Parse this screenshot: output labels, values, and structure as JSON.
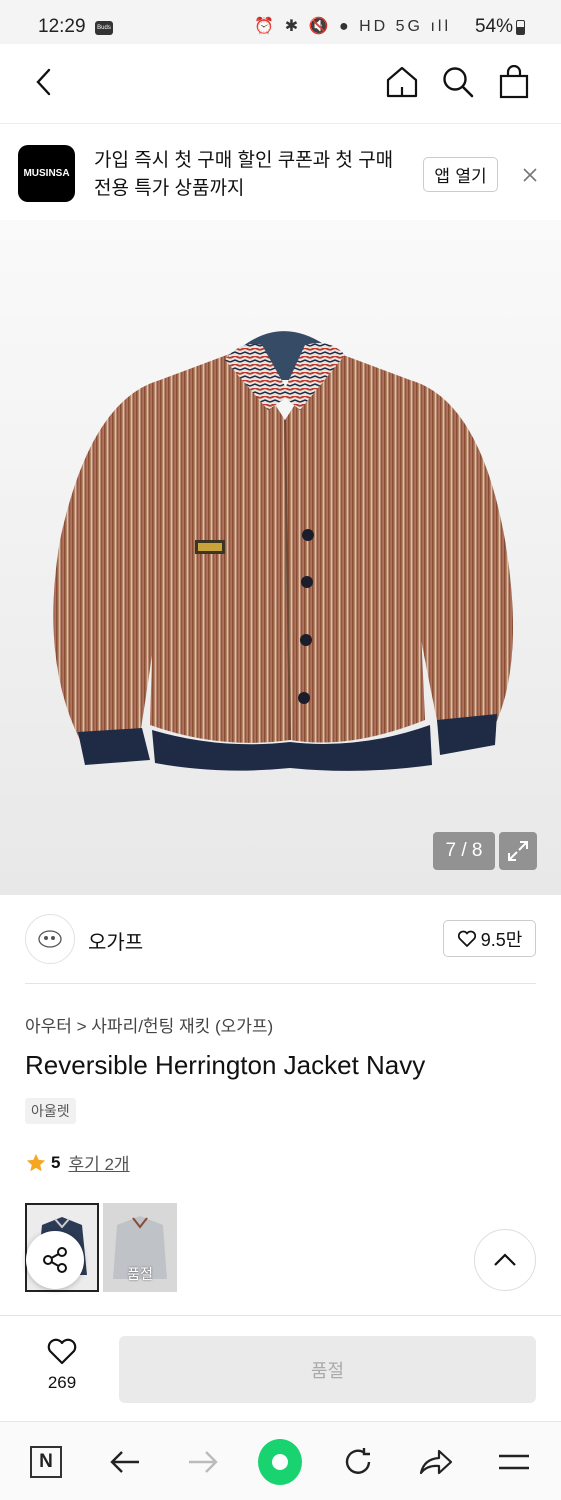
{
  "status_bar": {
    "time": "12:29",
    "buds_label": "Buds",
    "icons": "⏰ ✱ 🔇 ● HD 5G ıll",
    "battery": "54%"
  },
  "nav": {
    "back_icon": "chevron-left-icon",
    "home_icon": "home-icon",
    "search_icon": "search-icon",
    "cart_icon": "bag-icon"
  },
  "banner": {
    "logo_text": "MUSINSA",
    "message": "가입 즉시 첫 구매 할인 쿠폰과 첫 구매 전용 특가 상품까지",
    "open_app_label": "앱 열기"
  },
  "gallery": {
    "counter": "7 / 8"
  },
  "brand": {
    "name": "오가프",
    "likes": "9.5만"
  },
  "product": {
    "breadcrumb": "아우터 > 사파리/헌팅 재킷 (오가프)",
    "title": "Reversible Herrington Jacket Navy",
    "tag": "아울렛",
    "rating": "5",
    "review_label": "후기 2개",
    "thumbnails": [
      {
        "variant": "navy",
        "soldout": false
      },
      {
        "variant": "gray",
        "soldout_label": "품절"
      }
    ]
  },
  "action_bar": {
    "wish_count": "269",
    "soldout_label": "품절"
  },
  "colors": {
    "accent_green": "#18d36f",
    "star": "#f5a623"
  }
}
